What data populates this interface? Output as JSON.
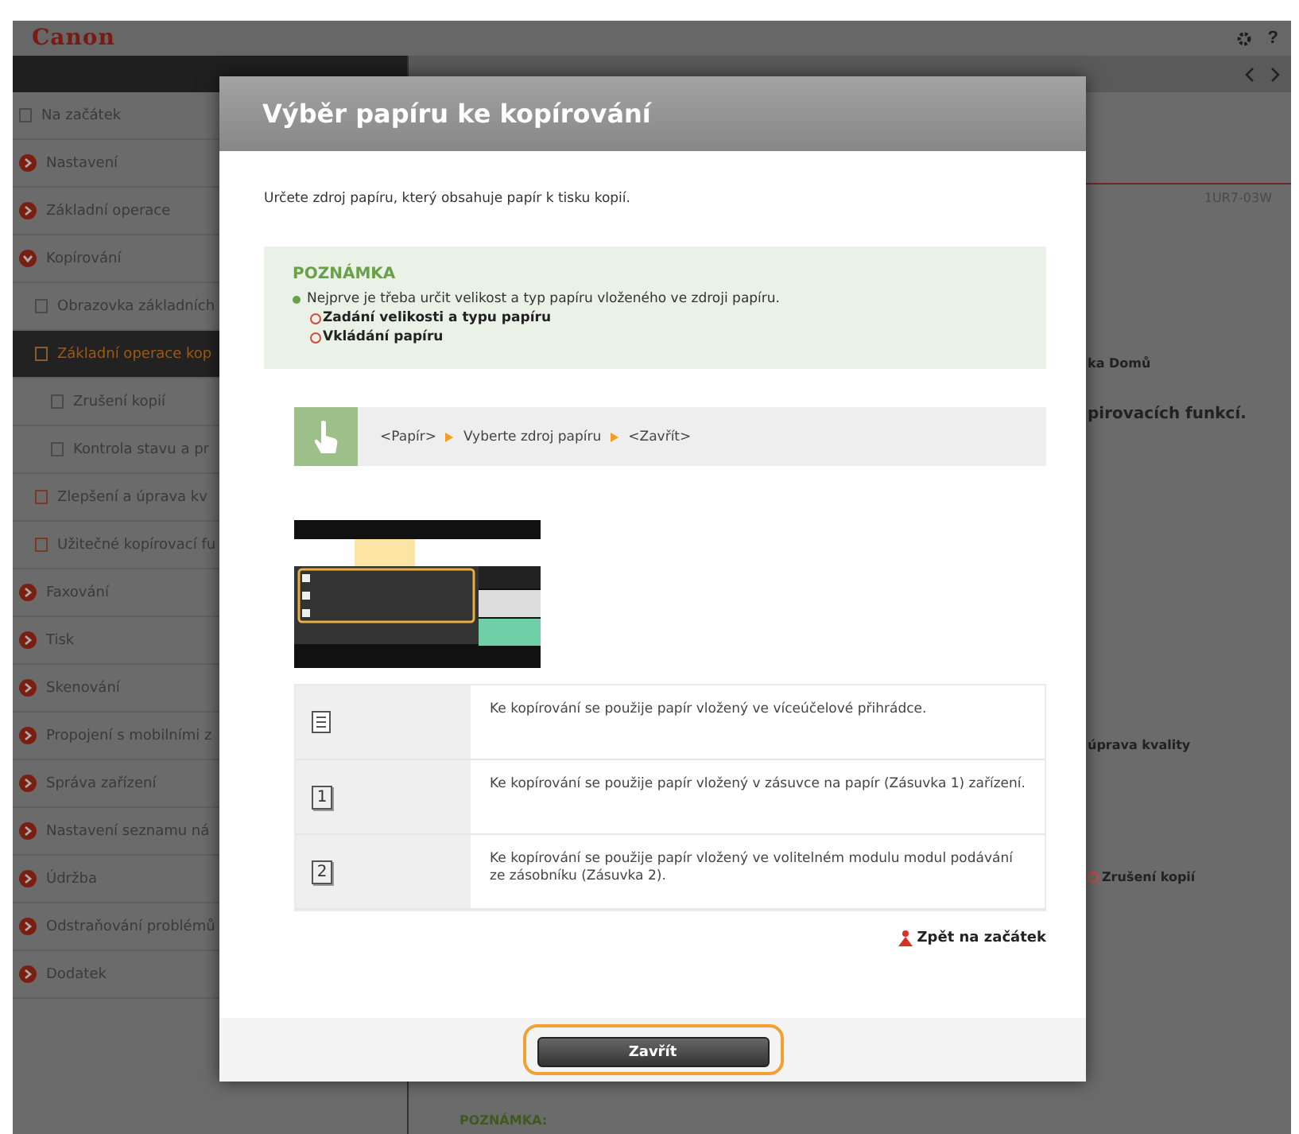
{
  "header": {
    "logo": "Canon",
    "help_label": "?"
  },
  "sidebar": {
    "items": [
      {
        "label": "Na začátek",
        "kind": "page",
        "selected": false
      },
      {
        "label": "Nastavení",
        "kind": "chapter",
        "expanded": false,
        "selected": false
      },
      {
        "label": "Základní operace",
        "kind": "chapter",
        "expanded": false,
        "selected": false
      },
      {
        "label": "Kopírování",
        "kind": "chapter",
        "expanded": true,
        "selected": false,
        "children": [
          {
            "label": "Obrazovka základních",
            "kind": "page",
            "selected": false
          },
          {
            "label": "Základní operace kop",
            "kind": "page",
            "selected": true,
            "children": [
              {
                "label": "Zrušení kopií",
                "kind": "page",
                "selected": false
              },
              {
                "label": "Kontrola stavu a pr",
                "kind": "page",
                "selected": false
              }
            ]
          },
          {
            "label": "Zlepšení a úprava kv",
            "kind": "section",
            "selected": false
          },
          {
            "label": "Užitečné kopírovací fu",
            "kind": "section",
            "selected": false
          }
        ]
      },
      {
        "label": "Faxování",
        "kind": "chapter",
        "expanded": false,
        "selected": false
      },
      {
        "label": "Tisk",
        "kind": "chapter",
        "expanded": false,
        "selected": false
      },
      {
        "label": "Skenování",
        "kind": "chapter",
        "expanded": false,
        "selected": false
      },
      {
        "label": "Propojení s mobilními z",
        "kind": "chapter",
        "expanded": false,
        "selected": false
      },
      {
        "label": "Správa zařízení",
        "kind": "chapter",
        "expanded": false,
        "selected": false
      },
      {
        "label": "Nastavení seznamu ná",
        "kind": "chapter",
        "expanded": false,
        "selected": false
      },
      {
        "label": "Údržba",
        "kind": "chapter",
        "expanded": false,
        "selected": false
      },
      {
        "label": "Odstraňování problémů",
        "kind": "chapter",
        "expanded": false,
        "selected": false
      },
      {
        "label": "Dodatek",
        "kind": "chapter",
        "expanded": false,
        "selected": false
      }
    ]
  },
  "content": {
    "doc_code": "1UR7-03W",
    "fragments": [
      {
        "text": "ka Domů",
        "kind": "text"
      },
      {
        "text": "pirovacích funkcí.",
        "kind": "heading"
      },
      {
        "text": "úprava kvality",
        "kind": "text"
      },
      {
        "text": "Zrušení kopií",
        "kind": "link"
      }
    ],
    "note_heading": "POZNÁMKA:"
  },
  "dialog": {
    "title": "Výběr papíru ke kopírování",
    "intro": "Určete zdroj papíru, který obsahuje papír k tisku kopií.",
    "note": {
      "heading": "POZNÁMKA",
      "text": "Nejprve je třeba určit velikost a typ papíru vloženého ve zdroji papíru.",
      "links": [
        "Zadání velikosti a typu papíru",
        "Vkládání papíru"
      ]
    },
    "steps": [
      "<Papír>",
      "Vyberte zdroj papíru",
      "<Zavřít>"
    ],
    "rows": [
      {
        "kind": "multipurpose",
        "text": "Ke kopírování se použije papír vložený ve víceúčelové přihrádce."
      },
      {
        "kind": "drawer",
        "label": "1",
        "text": "Ke kopírování se použije papír vložený v zásuvce na papír (Zásuvka 1) zařízení."
      },
      {
        "kind": "drawer",
        "label": "2",
        "text": "Ke kopírování se použije papír vložený ve volitelném modulu modul podávání ze zásobníku (Zásuvka 2)."
      }
    ],
    "back_link": "Zpět na začátek",
    "close_button": "Zavřít"
  }
}
